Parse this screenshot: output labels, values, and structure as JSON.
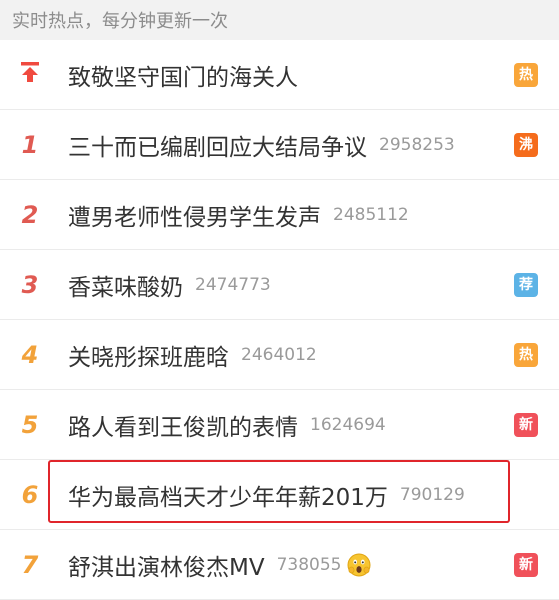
{
  "header": {
    "text": "实时热点，每分钟更新一次"
  },
  "items": [
    {
      "rank": "",
      "title": "致敬坚守国门的海关人",
      "count": "",
      "badge": "热"
    },
    {
      "rank": "1",
      "title": "三十而已编剧回应大结局争议",
      "count": "2958253",
      "badge": "沸"
    },
    {
      "rank": "2",
      "title": "遭男老师性侵男学生发声",
      "count": "2485112",
      "badge": ""
    },
    {
      "rank": "3",
      "title": "香菜味酸奶",
      "count": "2474773",
      "badge": "荐"
    },
    {
      "rank": "4",
      "title": "关晓彤探班鹿晗",
      "count": "2464012",
      "badge": "热"
    },
    {
      "rank": "5",
      "title": "路人看到王俊凯的表情",
      "count": "1624694",
      "badge": "新"
    },
    {
      "rank": "6",
      "title": "华为最高档天才少年年薪201万",
      "count": "790129",
      "badge": ""
    },
    {
      "rank": "7",
      "title": "舒淇出演林俊杰MV",
      "count": "738055",
      "badge": "新"
    }
  ],
  "icons": {
    "pinned": "pin-top-icon",
    "emoji": "screaming-face-emoji"
  },
  "colors": {
    "badge_hot": "#f9a63a",
    "badge_boil": "#f56c1c",
    "badge_recommend": "#5cb3e6",
    "badge_new": "#f0515a",
    "highlight": "#e0252b"
  }
}
